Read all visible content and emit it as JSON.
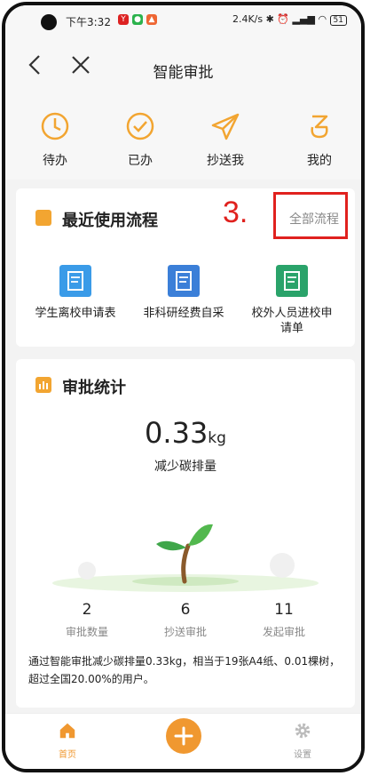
{
  "status": {
    "time": "下午3:32",
    "network": "2.4K/s",
    "battery": "51"
  },
  "nav": {
    "title": "智能审批",
    "back_icon": "back-arrow-icon",
    "close_icon": "close-icon"
  },
  "quick": [
    {
      "label": "待办",
      "icon": "clock-icon"
    },
    {
      "label": "已办",
      "icon": "check-circle-icon"
    },
    {
      "label": "抄送我",
      "icon": "paper-plane-icon"
    },
    {
      "label": "我的",
      "icon": "user-s-icon"
    }
  ],
  "recent": {
    "title": "最近使用流程",
    "all_link": "全部流程",
    "annotation": "3.",
    "items": [
      {
        "label": "学生离校申请表",
        "color": "#3a9be8"
      },
      {
        "label": "非科研经费自采",
        "color": "#3b7fd8"
      },
      {
        "label": "校外人员进校申请单",
        "color": "#2aa36a"
      }
    ]
  },
  "stats": {
    "title": "审批统计",
    "value": "0.33",
    "unit": "kg",
    "value_label": "减少碳排量",
    "columns": [
      {
        "num": "2",
        "label": "审批数量"
      },
      {
        "num": "6",
        "label": "抄送审批"
      },
      {
        "num": "11",
        "label": "发起审批"
      }
    ],
    "note": "通过智能审批减少碳排量0.33kg，相当于19张A4纸、0.01棵树，超过全国20.00%的用户。"
  },
  "tabs": {
    "home": "首页",
    "settings": "设置"
  },
  "colors": {
    "accent": "#f2a531",
    "highlight": "#e0211e"
  }
}
